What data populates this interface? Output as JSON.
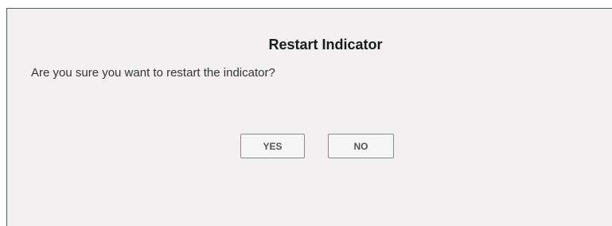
{
  "dialog": {
    "title": "Restart Indicator",
    "message": "Are you sure you want to restart the indicator?",
    "yes_label": "YES",
    "no_label": "NO"
  },
  "colors": {
    "background": "#f2f0f0",
    "button_border": "#8a8a8a",
    "text": "#333333"
  }
}
